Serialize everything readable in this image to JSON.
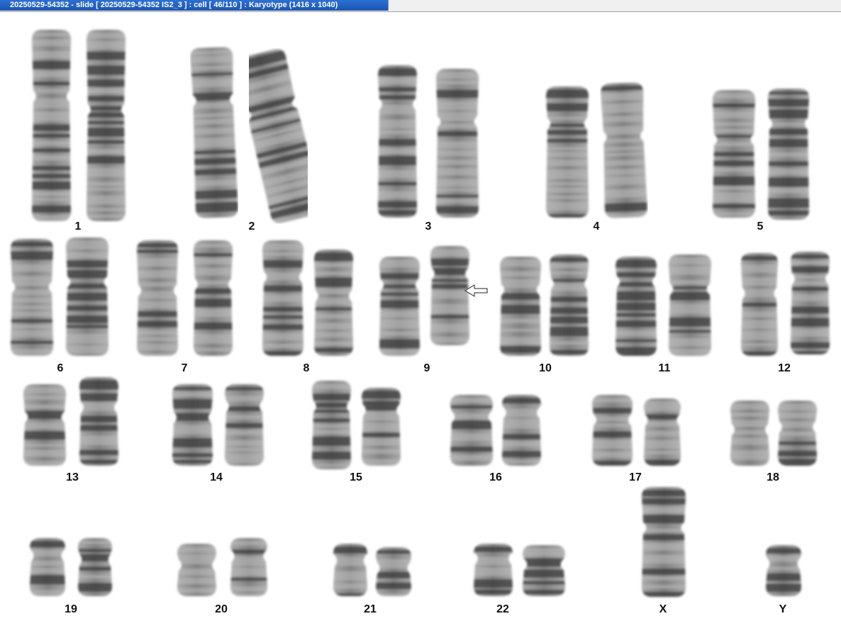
{
  "window": {
    "title": "20250529-54352 - slide [ 20250529-54352 IS2_3 ] : cell [ 46/110 ] : Karyotype  (1416 x 1040)"
  },
  "karyotype": {
    "labels": {
      "c1": "1",
      "c2": "2",
      "c3": "3",
      "c4": "4",
      "c5": "5",
      "c6": "6",
      "c7": "7",
      "c8": "8",
      "c9": "9",
      "c10": "10",
      "c11": "11",
      "c12": "12",
      "c13": "13",
      "c14": "14",
      "c15": "15",
      "c16": "16",
      "c17": "17",
      "c18": "18",
      "c19": "19",
      "c20": "20",
      "c21": "21",
      "c22": "22",
      "cX": "X",
      "cY": "Y"
    },
    "chromosome_counts": {
      "c1": 2,
      "c2": 2,
      "c3": 2,
      "c4": 2,
      "c5": 2,
      "c6": 2,
      "c7": 2,
      "c8": 2,
      "c9": 2,
      "c10": 2,
      "c11": 2,
      "c12": 2,
      "c13": 2,
      "c14": 2,
      "c15": 2,
      "c16": 2,
      "c17": 2,
      "c18": 2,
      "c19": 2,
      "c20": 2,
      "c21": 2,
      "c22": 2,
      "cX": 1,
      "cY": 1
    },
    "annotation": {
      "marker": "arrow-left-icon",
      "chromosome": "9"
    },
    "colors": {
      "chromosome_dark": "#3a3a3a",
      "chromosome_light": "#bdbdbd",
      "label": "#111111"
    }
  }
}
